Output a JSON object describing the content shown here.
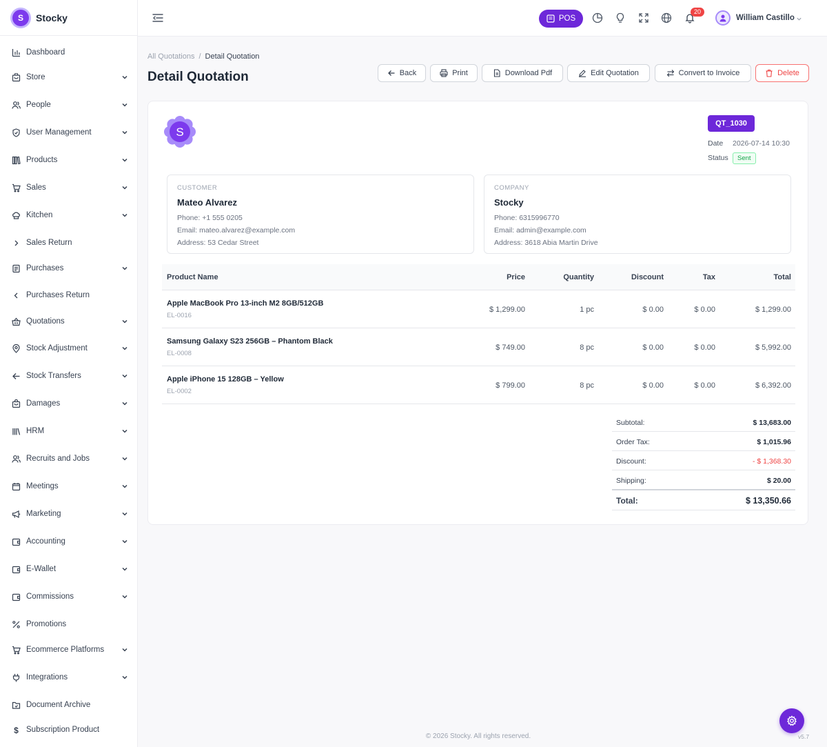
{
  "brand": {
    "name": "Stocky",
    "logo_letter": "S"
  },
  "sidebar": {
    "items": [
      {
        "label": "Dashboard",
        "icon": "chart-bar-icon",
        "chevron": "none"
      },
      {
        "label": "Store",
        "icon": "store-icon",
        "chevron": "down"
      },
      {
        "label": "People",
        "icon": "people-icon",
        "chevron": "down"
      },
      {
        "label": "User Management",
        "icon": "shield-icon",
        "chevron": "down"
      },
      {
        "label": "Products",
        "icon": "books-icon",
        "chevron": "down"
      },
      {
        "label": "Sales",
        "icon": "cart-icon",
        "chevron": "down"
      },
      {
        "label": "Kitchen",
        "icon": "chef-hat-icon",
        "chevron": "down"
      },
      {
        "label": "Sales Return",
        "icon": "chevron-right-icon",
        "chevron": "none"
      },
      {
        "label": "Purchases",
        "icon": "receipt-icon",
        "chevron": "down"
      },
      {
        "label": "Purchases Return",
        "icon": "chevron-left-icon",
        "chevron": "none"
      },
      {
        "label": "Quotations",
        "icon": "basket-icon",
        "chevron": "down"
      },
      {
        "label": "Stock Adjustment",
        "icon": "location-icon",
        "chevron": "down"
      },
      {
        "label": "Stock Transfers",
        "icon": "arrow-left-icon",
        "chevron": "down"
      },
      {
        "label": "Damages",
        "icon": "bag-icon",
        "chevron": "down"
      },
      {
        "label": "HRM",
        "icon": "library-icon",
        "chevron": "down"
      },
      {
        "label": "Recruits and Jobs",
        "icon": "people-icon",
        "chevron": "down"
      },
      {
        "label": "Meetings",
        "icon": "calendar-icon",
        "chevron": "down"
      },
      {
        "label": "Marketing",
        "icon": "megaphone-icon",
        "chevron": "down"
      },
      {
        "label": "Accounting",
        "icon": "wallet-icon",
        "chevron": "down"
      },
      {
        "label": "E-Wallet",
        "icon": "wallet-icon",
        "chevron": "down"
      },
      {
        "label": "Commissions",
        "icon": "wallet-icon",
        "chevron": "down"
      },
      {
        "label": "Promotions",
        "icon": "percent-icon",
        "chevron": "none"
      },
      {
        "label": "Ecommerce Platforms",
        "icon": "cart-icon",
        "chevron": "down"
      },
      {
        "label": "Integrations",
        "icon": "plug-icon",
        "chevron": "down"
      },
      {
        "label": "Document Archive",
        "icon": "folder-icon",
        "chevron": "none"
      },
      {
        "label": "Subscription Product",
        "icon": "dollar-icon",
        "chevron": "none"
      }
    ]
  },
  "header": {
    "pos_label": "POS",
    "notification_count": "20",
    "user_name": "William Castillo"
  },
  "breadcrumb": {
    "parent": "All Quotations",
    "separator": "/",
    "current": "Detail Quotation"
  },
  "page_title": "Detail Quotation",
  "actions": {
    "back": "Back",
    "print": "Print",
    "download": "Download Pdf",
    "edit": "Edit Quotation",
    "convert": "Convert to Invoice",
    "delete": "Delete"
  },
  "quotation": {
    "ref": "QT_1030",
    "date_label": "Date",
    "date": "2026-07-14 10:30",
    "status_label": "Status",
    "status": "Sent"
  },
  "customer": {
    "title": "CUSTOMER",
    "name": "Mateo Alvarez",
    "phone": "Phone: +1 555 0205",
    "email": "Email: mateo.alvarez@example.com",
    "address": "Address: 53 Cedar Street"
  },
  "company": {
    "title": "COMPANY",
    "name": "Stocky",
    "phone": "Phone: 6315996770",
    "email": "Email: admin@example.com",
    "address": "Address: 3618 Abia Martin Drive"
  },
  "table": {
    "headers": [
      "Product Name",
      "Price",
      "Quantity",
      "Discount",
      "Tax",
      "Total"
    ],
    "rows": [
      {
        "name": "Apple MacBook Pro 13-inch M2 8GB/512GB",
        "code": "EL-0016",
        "price": "$ 1,299.00",
        "qty": "1 pc",
        "discount": "$ 0.00",
        "tax": "$ 0.00",
        "total": "$ 1,299.00"
      },
      {
        "name": "Samsung Galaxy S23 256GB – Phantom Black",
        "code": "EL-0008",
        "price": "$ 749.00",
        "qty": "8 pc",
        "discount": "$ 0.00",
        "tax": "$ 0.00",
        "total": "$ 5,992.00"
      },
      {
        "name": "Apple iPhone 15 128GB – Yellow",
        "code": "EL-0002",
        "price": "$ 799.00",
        "qty": "8 pc",
        "discount": "$ 0.00",
        "tax": "$ 0.00",
        "total": "$ 6,392.00"
      }
    ]
  },
  "totals": {
    "subtotal_label": "Subtotal:",
    "subtotal": "$ 13,683.00",
    "tax_label": "Order Tax:",
    "tax": "$ 1,015.96",
    "discount_label": "Discount:",
    "discount": "- $ 1,368.30",
    "shipping_label": "Shipping:",
    "shipping": "$ 20.00",
    "total_label": "Total:",
    "total": "$ 13,350.66"
  },
  "footer": "© 2026 Stocky. All rights reserved.",
  "version": "v5.7",
  "colors": {
    "accent": "#6d28d9",
    "danger": "#ef4444",
    "success": "#16a34a"
  }
}
